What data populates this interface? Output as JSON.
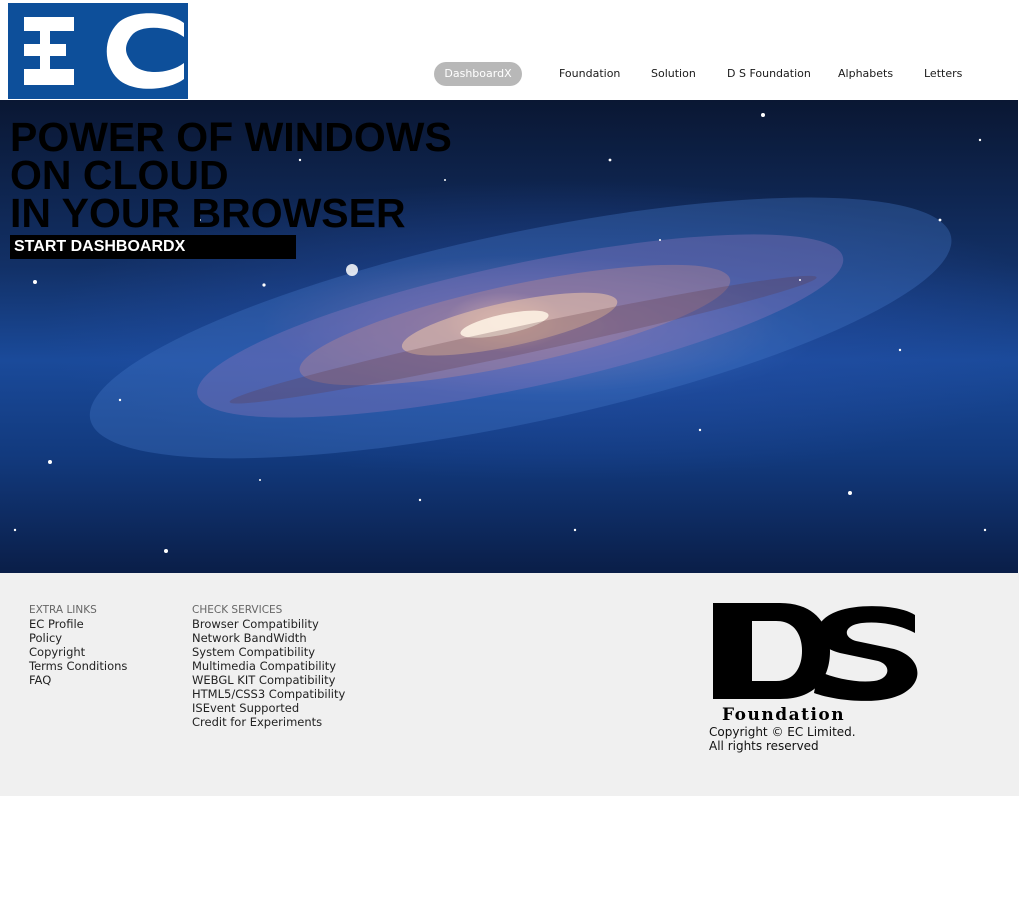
{
  "header": {
    "logo_text": "EC",
    "nav": [
      {
        "label": "DashboardX",
        "active": true
      },
      {
        "label": "Foundation",
        "active": false
      },
      {
        "label": "Solution",
        "active": false
      },
      {
        "label": "D S Foundation",
        "active": false
      },
      {
        "label": "Alphabets",
        "active": false
      },
      {
        "label": "Letters",
        "active": false
      }
    ]
  },
  "hero": {
    "lines": [
      "POWER OF WINDOWS",
      "ON CLOUD",
      "IN YOUR BROWSER"
    ],
    "cta": "START DASHBOARDX"
  },
  "footer": {
    "extra_links": {
      "heading": "EXTRA LINKS",
      "items": [
        "EC Profile",
        "Policy",
        "Copyright",
        "Terms Conditions",
        "FAQ"
      ]
    },
    "check_services": {
      "heading": "CHECK SERVICES",
      "items": [
        "Browser Compatibility",
        "Network BandWidth",
        "System Compatibility",
        "Multimedia Compatibility",
        "WEBGL KIT Compatibility",
        "HTML5/CSS3 Compatibility",
        "ISEvent Supported",
        "Credit for Experiments"
      ]
    },
    "ds_logo": {
      "letters": "DS",
      "word": "Foundation"
    },
    "copyright": [
      "Copyright © EC Limited.",
      "All rights reserved"
    ]
  },
  "colors": {
    "logo_blue": "#0d4f9a",
    "nav_active_bg": "#b8b8b8",
    "footer_bg": "#f0f0f0",
    "hero_text": "#000000",
    "cta_bg": "#000000"
  }
}
